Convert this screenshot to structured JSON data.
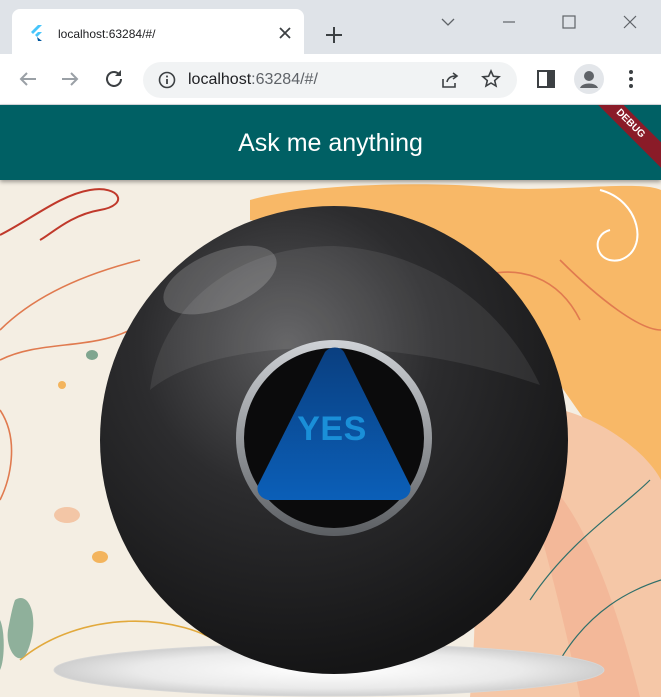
{
  "browser": {
    "tab_title": "localhost:63284/#/",
    "url_host": "localhost",
    "url_rest": ":63284/#/"
  },
  "app": {
    "title": "Ask me anything",
    "debug_label": "DEBUG",
    "answer": "YES",
    "colors": {
      "appbar": "#006064",
      "answer_text": "#1a8fd8",
      "triangle": "#0a4f9c",
      "ball": "#2a2a2c"
    }
  },
  "icons": [
    "flutter-logo-icon",
    "close-icon",
    "plus-icon",
    "chevron-down-icon",
    "minimize-icon",
    "maximize-icon",
    "window-close-icon",
    "back-arrow-icon",
    "forward-arrow-icon",
    "reload-icon",
    "info-icon",
    "share-icon",
    "star-icon",
    "side-panel-icon",
    "profile-icon",
    "more-vert-icon"
  ]
}
